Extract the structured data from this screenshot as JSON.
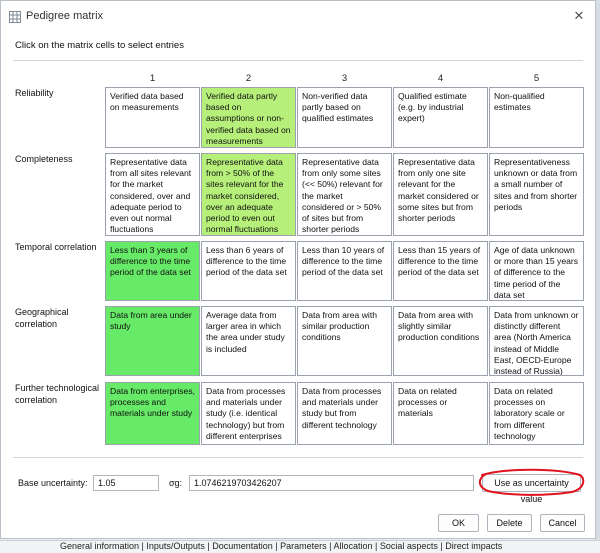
{
  "window": {
    "title": "Pedigree matrix",
    "close_glyph": "✕"
  },
  "instructions": "Click on the matrix cells to select entries",
  "columns": [
    "1",
    "2",
    "3",
    "4",
    "5"
  ],
  "rows": [
    {
      "label": "Reliability",
      "cells": [
        "Verified data based on measurements",
        "Verified data partly based on assumptions or non-verified data based on measurements",
        "Non-verified data partly based on qualified estimates",
        "Qualified estimate (e.g. by industrial expert)",
        "Non-qualified estimates"
      ],
      "selected": 1
    },
    {
      "label": "Completeness",
      "cells": [
        "Representative data from all sites relevant for the market considered, over and adequate period to even out normal fluctuations",
        "Representative data from > 50% of the sites relevant for the market considered, over an adequate period to even out normal fluctuations",
        "Representative data from only some sites (<< 50%) relevant for the market considered or > 50% of sites but from shorter periods",
        "Representative data from only one site relevant for the market considered or some sites but from shorter periods",
        "Representativeness unknown or data from a small number of sites and from shorter periods"
      ],
      "selected": 1
    },
    {
      "label": "Temporal correlation",
      "cells": [
        "Less than 3 years of difference to the time period of the data set",
        "Less than 6 years of difference to the time period of the data set",
        "Less than 10 years of difference to the time period of the data set",
        "Less than 15 years of difference to the time period of the data set",
        "Age of data unknown or more than 15 years of difference to the time period of the data set"
      ],
      "selected": 0
    },
    {
      "label": "Geographical correlation",
      "cells": [
        "Data from area under study",
        "Average data from larger area in which the area under study is included",
        "Data from area with similar production conditions",
        "Data from area with slightly similar production conditions",
        "Data from unknown or distinctly different area (North America instead of Middle East, OECD-Europe instead of Russia)"
      ],
      "selected": 0
    },
    {
      "label": "Further technological correlation",
      "cells": [
        "Data from enterprises, processes and materials under study",
        "Data from processes and materials under study (i.e. identical technology) but from different enterprises",
        "Data from processes and materials under study but from different technology",
        "Data on related processes or materials",
        "Data on related processes on laboratory scale or from different technology"
      ],
      "selected": 0
    }
  ],
  "uncertainty": {
    "base_label": "Base uncertainty:",
    "base_value": "1.05",
    "sigma_label": "σg:",
    "sigma_value": "1.0746219703426207",
    "use_button": "Use as uncertainty value"
  },
  "buttons": {
    "ok": "OK",
    "delete": "Delete",
    "cancel": "Cancel"
  },
  "background_tabs": "General information | Inputs/Outputs | Documentation | Parameters | Allocation | Social aspects | Direct impacts",
  "colors": {
    "selected_bright": "#66ea67",
    "selected_light": "#b6f07a",
    "annotation": "#e0141e"
  }
}
